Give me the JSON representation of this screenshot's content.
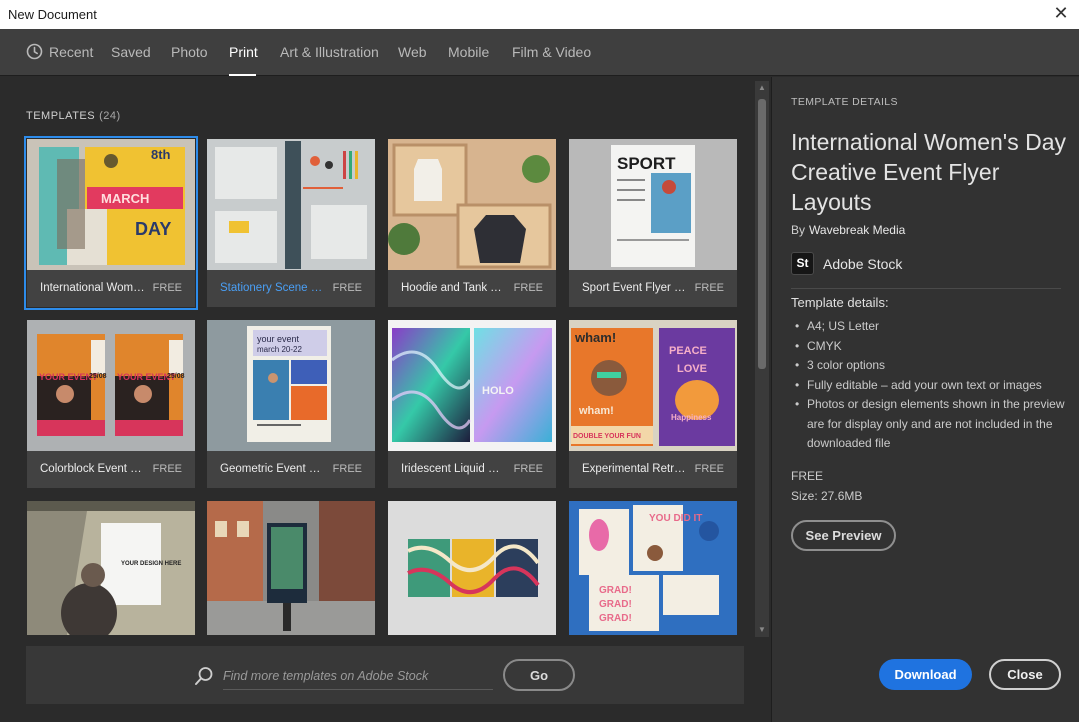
{
  "window": {
    "title": "New Document",
    "close_glyph": "✕"
  },
  "nav": {
    "tabs": [
      {
        "label": "Recent",
        "icon": "clock-icon"
      },
      {
        "label": "Saved"
      },
      {
        "label": "Photo"
      },
      {
        "label": "Print",
        "active": true
      },
      {
        "label": "Art & Illustration"
      },
      {
        "label": "Web"
      },
      {
        "label": "Mobile"
      },
      {
        "label": "Film & Video"
      }
    ]
  },
  "templates": {
    "heading": "TEMPLATES",
    "count": "(24)",
    "items": [
      {
        "name": "International Wome...",
        "price": "FREE",
        "selected": true
      },
      {
        "name": "Stationery Scene Mo...",
        "price": "FREE",
        "link": true
      },
      {
        "name": "Hoodie and Tank To...",
        "price": "FREE"
      },
      {
        "name": "Sport Event Flyer La...",
        "price": "FREE"
      },
      {
        "name": "Colorblock Event Fly...",
        "price": "FREE"
      },
      {
        "name": "Geometric Event Fly...",
        "price": "FREE"
      },
      {
        "name": "Iridescent Liquid Pos...",
        "price": "FREE"
      },
      {
        "name": "Experimental Retro...",
        "price": "FREE"
      },
      {
        "name": "",
        "price": ""
      },
      {
        "name": "",
        "price": ""
      },
      {
        "name": "",
        "price": ""
      },
      {
        "name": "",
        "price": ""
      }
    ],
    "thumb_text": {
      "march_8th": "8th",
      "march": "MARCH",
      "day": "DAY",
      "sport": "SPORT",
      "your_event": "YOUR EVENT",
      "date_short": "25/08",
      "geo_title": "your event",
      "geo_date": "march 20-22",
      "holo": "HOLO",
      "wham": "wham!",
      "peace": "PEACE",
      "love": "LOVE",
      "happiness": "Happiness",
      "double_fun": "DOUBLE YOUR FUN",
      "your_design": "YOUR DESIGN HERE",
      "you_did_it": "YOU DID IT",
      "grad": "GRAD!"
    }
  },
  "search": {
    "placeholder": "Find more templates on Adobe Stock",
    "button": "Go"
  },
  "details": {
    "label": "TEMPLATE DETAILS",
    "title": "International Women's Day Creative Event Flyer Layouts",
    "by": "By",
    "author": "Wavebreak Media",
    "stock_badge": "St",
    "stock_label": "Adobe Stock",
    "subheading": "Template details:",
    "bullets": [
      "A4; US Letter",
      "CMYK",
      "3 color options",
      "Fully editable – add your own text or images",
      "Photos or design elements shown in the preview are for display only and are not included in the downloaded file"
    ],
    "price": "FREE",
    "size": "Size: 27.6MB",
    "preview_button": "See Preview",
    "download_button": "Download",
    "close_button": "Close"
  },
  "colors": {
    "accent": "#1f73e0",
    "link": "#4a9ff5",
    "selection": "#2d8ceb"
  }
}
